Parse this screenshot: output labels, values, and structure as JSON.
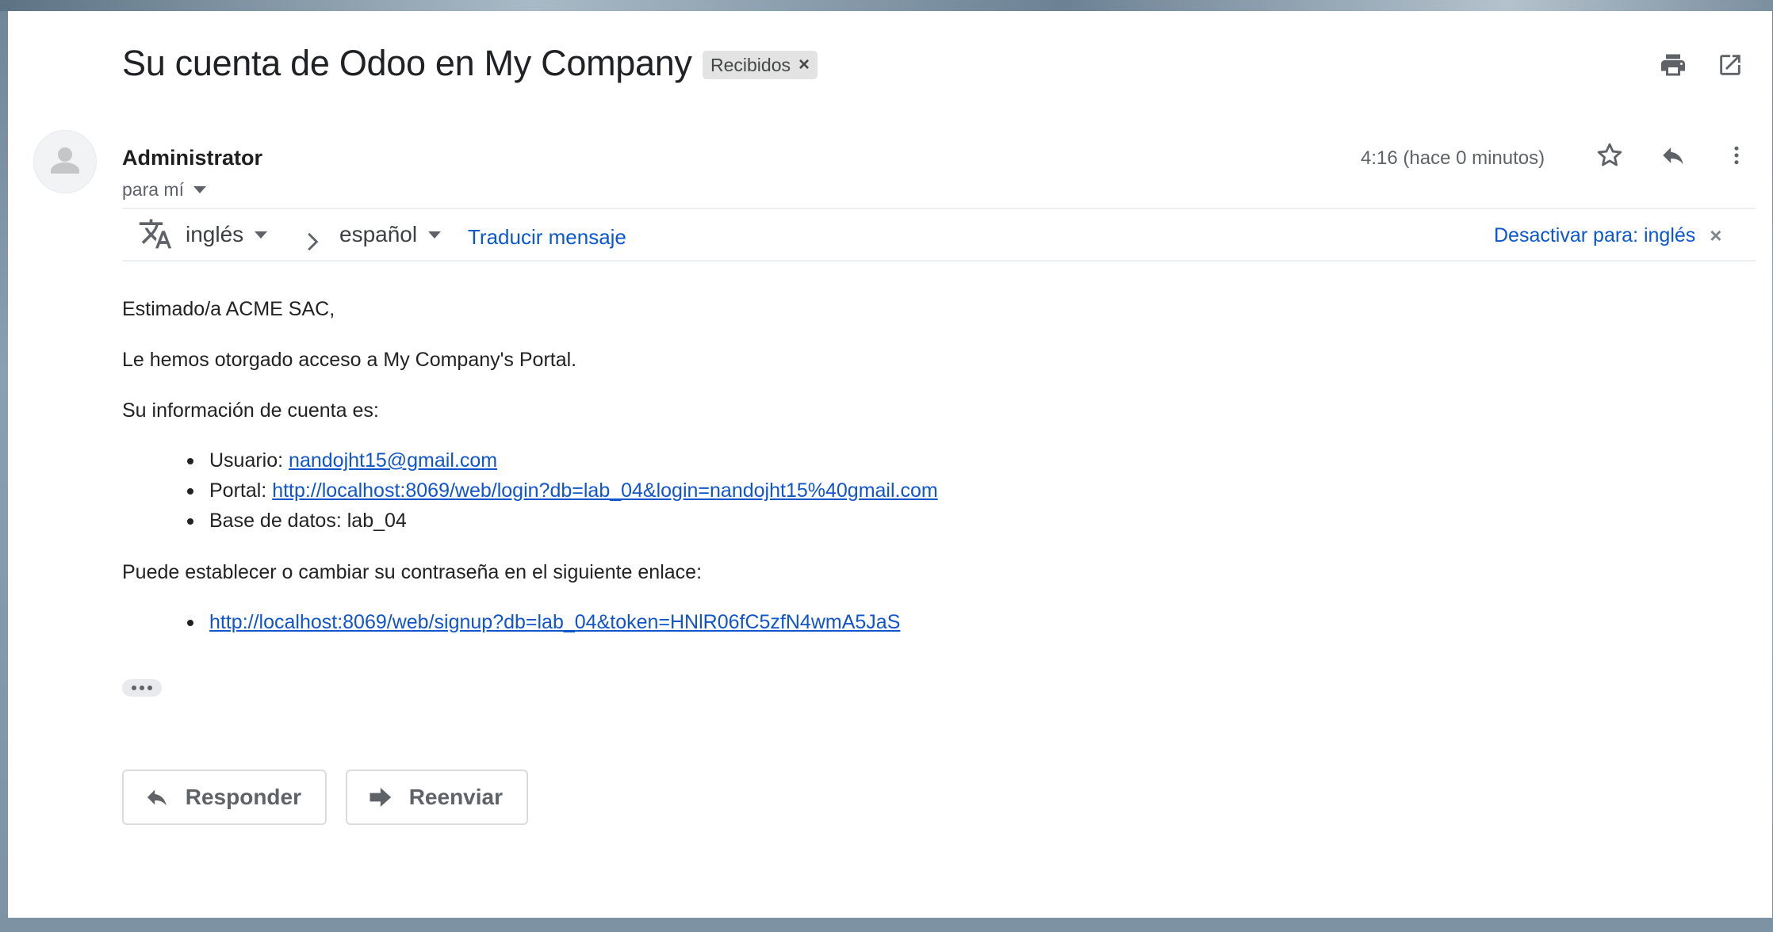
{
  "email": {
    "subject": "Su cuenta de Odoo en My Company",
    "label_chip": "Recibidos",
    "label_chip_close": "×",
    "sender": "Administrator",
    "recipient": "para mí",
    "time": "4:16 (hace 0 minutos)"
  },
  "translate_bar": {
    "source_language": "inglés",
    "target_language": "español",
    "translate_link": "Traducir mensaje",
    "disable_link": "Desactivar para: inglés",
    "disable_close": "×"
  },
  "message": {
    "greeting": "Estimado/a ACME SAC,",
    "access_line": "Le hemos otorgado acceso a My Company's Portal.",
    "account_info_intro": "Su información de cuenta es:",
    "account_items": [
      {
        "label": "Usuario: ",
        "value": "nandojht15@gmail.com"
      },
      {
        "label": "Portal: ",
        "value": "http://localhost:8069/web/login?db=lab_04&login=nandojht15%40gmail.com"
      },
      {
        "label": "Base de datos: ",
        "value": "lab_04"
      }
    ],
    "password_intro": "Puede establecer o cambiar su contraseña en el siguiente enlace:",
    "signup_link": "http://localhost:8069/web/signup?db=lab_04&token=HNlR06fC5zfN4wmA5JaS"
  },
  "actions": {
    "reply": "Responder",
    "forward": "Reenviar"
  },
  "icons": {
    "print": "print-icon",
    "open_new_window": "open-in-new-window-icon",
    "star": "star-icon",
    "reply": "reply-icon",
    "more": "more-vertical-icon",
    "translate": "translate-icon",
    "forward": "forward-icon"
  },
  "colors": {
    "link": "#0b57d0",
    "mail_link": "#1155cc",
    "text": "#222222",
    "muted": "#5f6368",
    "chip_bg": "#e3e3e3"
  }
}
